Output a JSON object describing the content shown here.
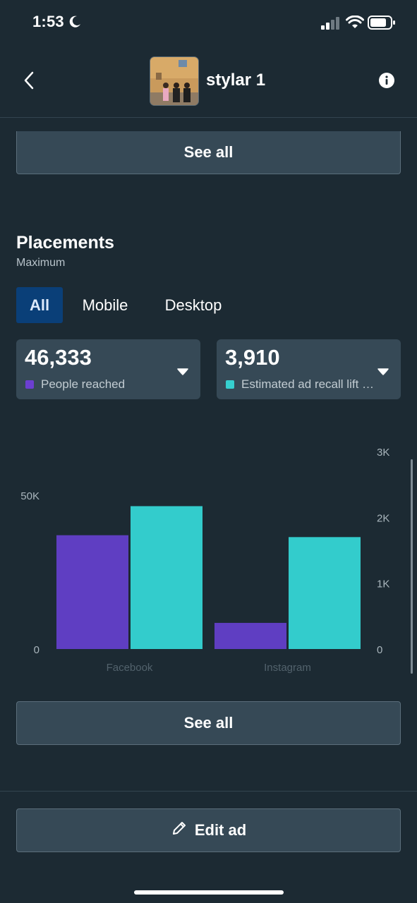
{
  "status_bar": {
    "time": "1:53"
  },
  "header": {
    "title": "stylar 1"
  },
  "buttons": {
    "see_all_top": "See all",
    "see_all_bottom": "See all",
    "edit_ad": "Edit ad"
  },
  "placements": {
    "title": "Placements",
    "subtitle": "Maximum",
    "tabs": [
      {
        "label": "All",
        "selected": true
      },
      {
        "label": "Mobile",
        "selected": false
      },
      {
        "label": "Desktop",
        "selected": false
      }
    ],
    "metrics": [
      {
        "value": "46,333",
        "label": "People reached",
        "color": "#6c3fd1"
      },
      {
        "value": "3,910",
        "label": "Estimated ad recall lift (people)",
        "color": "#36cfcf"
      }
    ]
  },
  "chart_data": {
    "type": "bar",
    "categories": [
      "Facebook",
      "Instagram"
    ],
    "series": [
      {
        "name": "People reached",
        "axis": "left",
        "color": "#5f3ec2",
        "values": [
          37000,
          8500
        ]
      },
      {
        "name": "Estimated ad recall lift (people)",
        "axis": "right",
        "color": "#33cccc",
        "values": [
          2170,
          1700
        ]
      }
    ],
    "left_axis": {
      "ticks": [
        "0",
        "50K"
      ],
      "tick_values": [
        0,
        50000
      ],
      "ylim": [
        0,
        50000
      ]
    },
    "right_axis": {
      "ticks": [
        "0",
        "1K",
        "2K",
        "3K"
      ],
      "tick_values": [
        0,
        1000,
        2000,
        3000
      ],
      "ylim": [
        0,
        3000
      ]
    },
    "grid": false
  }
}
